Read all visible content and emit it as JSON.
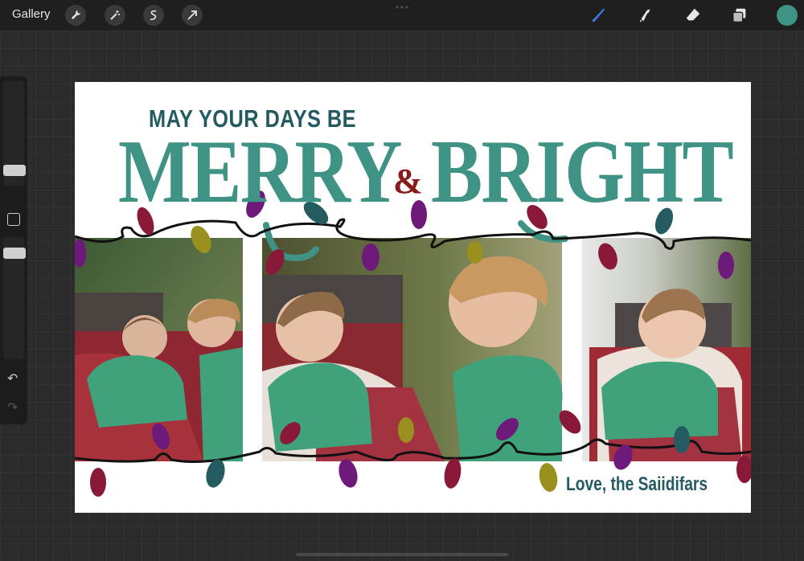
{
  "app": {
    "gallery_label": "Gallery",
    "left_tools": [
      "wrench-icon",
      "magic-wand-icon",
      "selection-icon",
      "transform-arrow-icon"
    ],
    "right_tools": [
      "brush-icon",
      "smudge-icon",
      "eraser-icon",
      "layers-icon"
    ],
    "active_color": "#3f9384",
    "active_tool_color": "#3d7fe0"
  },
  "sidebar": {
    "undo_icon": "undo-icon",
    "redo_icon": "redo-icon"
  },
  "artwork": {
    "subtitle": "MAY YOUR DAYS BE",
    "headline_left": "MERRY",
    "ampersand": "&",
    "headline_right": "BRIGHT",
    "signature": "Love, the Saiidifars",
    "colors": {
      "teal": "#3f9384",
      "dark_teal": "#245b60",
      "maroon": "#8b1a1a",
      "purple": "#6e1a7a",
      "olive": "#9a9020",
      "dark_teal_bulb": "#245b60",
      "wine": "#8a1838"
    },
    "photos": [
      "photo-left",
      "photo-center",
      "photo-right"
    ]
  }
}
